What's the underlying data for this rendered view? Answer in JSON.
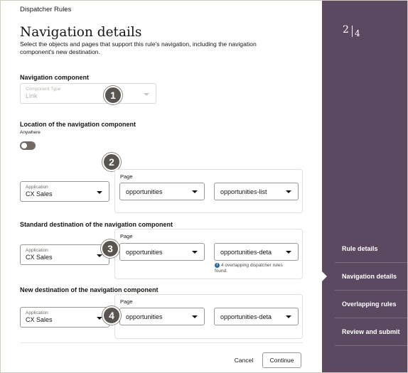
{
  "header": {
    "breadcrumb": "Dispatcher Rules",
    "title": "Navigation details",
    "description": "Select the objects and pages that support this rule's navigation, including the navigation component's new destination."
  },
  "navigation_component": {
    "heading": "Navigation component",
    "field_label": "Component Type",
    "field_value": "Link",
    "badge": "1"
  },
  "location": {
    "heading": "Location of the navigation component",
    "sub_label": "Anywhere",
    "badge": "2",
    "application_label": "Application",
    "application_value": "CX Sales",
    "page_label": "Page",
    "page_value": "opportunities",
    "subpage_value": "opportunities-list"
  },
  "standard_destination": {
    "heading": "Standard destination of the navigation component",
    "badge": "3",
    "application_label": "Application",
    "application_value": "CX Sales",
    "page_label": "Page",
    "page_value": "opportunities",
    "subpage_value": "opportunities-deta",
    "info_icon": "info-icon",
    "info_text": "4 overlapping dispatcher rules found."
  },
  "new_destination": {
    "heading": "New destination of the navigation component",
    "badge": "4",
    "application_label": "Application",
    "application_value": "CX Sales",
    "page_label": "Page",
    "page_value": "opportunities",
    "subpage_value": "opportunities-deta"
  },
  "footer": {
    "cancel_label": "Cancel",
    "continue_label": "Continue"
  },
  "side_panel": {
    "current_step": "2",
    "total_steps": "4",
    "steps": [
      "Rule details",
      "Navigation details",
      "Overlapping rules",
      "Review and submit"
    ],
    "active_step": "Navigation details"
  },
  "colors": {
    "side_panel_bg": "#5b4962",
    "badge_bg": "#5a5550",
    "info_icon": "#2b6a96"
  }
}
